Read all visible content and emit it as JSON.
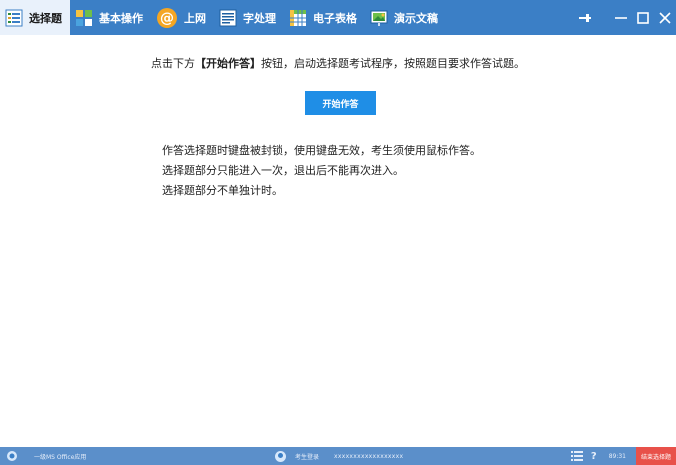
{
  "toolbar": {
    "tabs": [
      {
        "label": "选择题",
        "icon": "choice-list-icon",
        "active": true
      },
      {
        "label": "基本操作",
        "icon": "basic-ops-icon",
        "active": false
      },
      {
        "label": "上网",
        "icon": "internet-at-icon",
        "active": false
      },
      {
        "label": "字处理",
        "icon": "word-processing-icon",
        "active": false
      },
      {
        "label": "电子表格",
        "icon": "spreadsheet-icon",
        "active": false
      },
      {
        "label": "演示文稿",
        "icon": "presentation-icon",
        "active": false
      }
    ],
    "window_controls": [
      "pin-icon",
      "minimize-icon",
      "maximize-icon",
      "close-icon"
    ]
  },
  "main": {
    "instruction_prefix": "点击下方",
    "instruction_highlight": "【开始作答】",
    "instruction_suffix": "按钮，启动选择题考试程序，按照题目要求作答试题。",
    "start_button": "开始作答",
    "notes": [
      "作答选择题时键盘被封锁，使用键盘无效，考生须使用鼠标作答。",
      "选择题部分只能进入一次，退出后不能再次进入。",
      "选择题部分不单独计时。"
    ]
  },
  "statusbar": {
    "exam_name": "一级MS Office应用",
    "candidate_label": "考生登录",
    "registration_number": "xxxxxxxxxxxxxxxxxx",
    "time": "89:31",
    "end_button": "结束选择题"
  },
  "colors": {
    "toolbar_bg": "#3b7fc6",
    "active_tab_bg": "#e9f1fb",
    "start_button_bg": "#1f8ee6",
    "statusbar_bg": "#5b8fca",
    "end_button_bg": "#e8514a"
  }
}
